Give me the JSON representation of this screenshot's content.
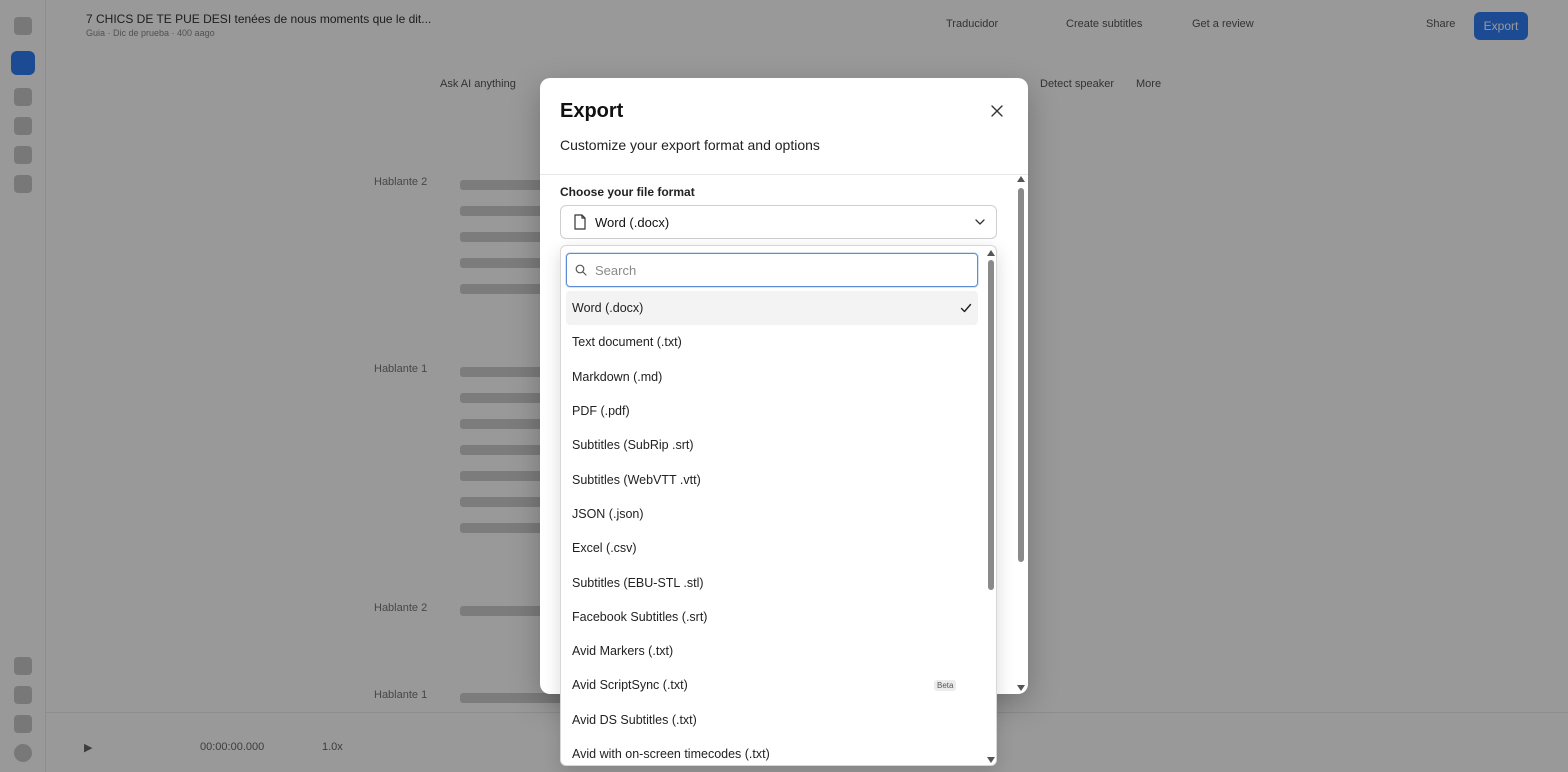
{
  "background": {
    "doc_title": "7 CHICS DE TE PUE DESI tenées de nous moments que le dit...",
    "doc_subtitle": "Guia · Dic de prueba · 400 aago",
    "top_items": [
      "Traducidor",
      "Create subtitles",
      "Get a review",
      "Share"
    ],
    "export_button": "Export",
    "toolbar_left": "Ask AI anything",
    "toolbar_right": [
      "Detect speaker",
      "More"
    ],
    "speakers": [
      "Hablante 2",
      "Hablante 1",
      "Hablante 2",
      "Hablante 1"
    ],
    "timecode": "00:00:00.000",
    "speed": "1.0x"
  },
  "modal": {
    "title": "Export",
    "description": "Customize your export format and options",
    "format_label": "Choose your file format",
    "selected_format": "Word (.docx)",
    "file_icon": "file-icon",
    "chevron_icon": "chevron-down-icon",
    "close_icon": "close-icon"
  },
  "dropdown": {
    "search_placeholder": "Search",
    "search_value": "",
    "options": [
      {
        "label": "Word (.docx)",
        "selected": true,
        "badge": ""
      },
      {
        "label": "Text document (.txt)",
        "selected": false,
        "badge": ""
      },
      {
        "label": "Markdown (.md)",
        "selected": false,
        "badge": ""
      },
      {
        "label": "PDF (.pdf)",
        "selected": false,
        "badge": ""
      },
      {
        "label": "Subtitles (SubRip .srt)",
        "selected": false,
        "badge": ""
      },
      {
        "label": "Subtitles (WebVTT .vtt)",
        "selected": false,
        "badge": ""
      },
      {
        "label": "JSON (.json)",
        "selected": false,
        "badge": ""
      },
      {
        "label": "Excel (.csv)",
        "selected": false,
        "badge": ""
      },
      {
        "label": "Subtitles (EBU-STL .stl)",
        "selected": false,
        "badge": ""
      },
      {
        "label": "Facebook Subtitles (.srt)",
        "selected": false,
        "badge": ""
      },
      {
        "label": "Avid Markers (.txt)",
        "selected": false,
        "badge": ""
      },
      {
        "label": "Avid ScriptSync (.txt)",
        "selected": false,
        "badge": "Beta"
      },
      {
        "label": "Avid DS Subtitles (.txt)",
        "selected": false,
        "badge": ""
      },
      {
        "label": "Avid with on-screen timecodes (.txt)",
        "selected": false,
        "badge": ""
      }
    ]
  },
  "colors": {
    "accent": "#2f7cf6",
    "overlay": "rgba(0,0,0,0.40)",
    "focus_border": "#5b8dd6"
  }
}
